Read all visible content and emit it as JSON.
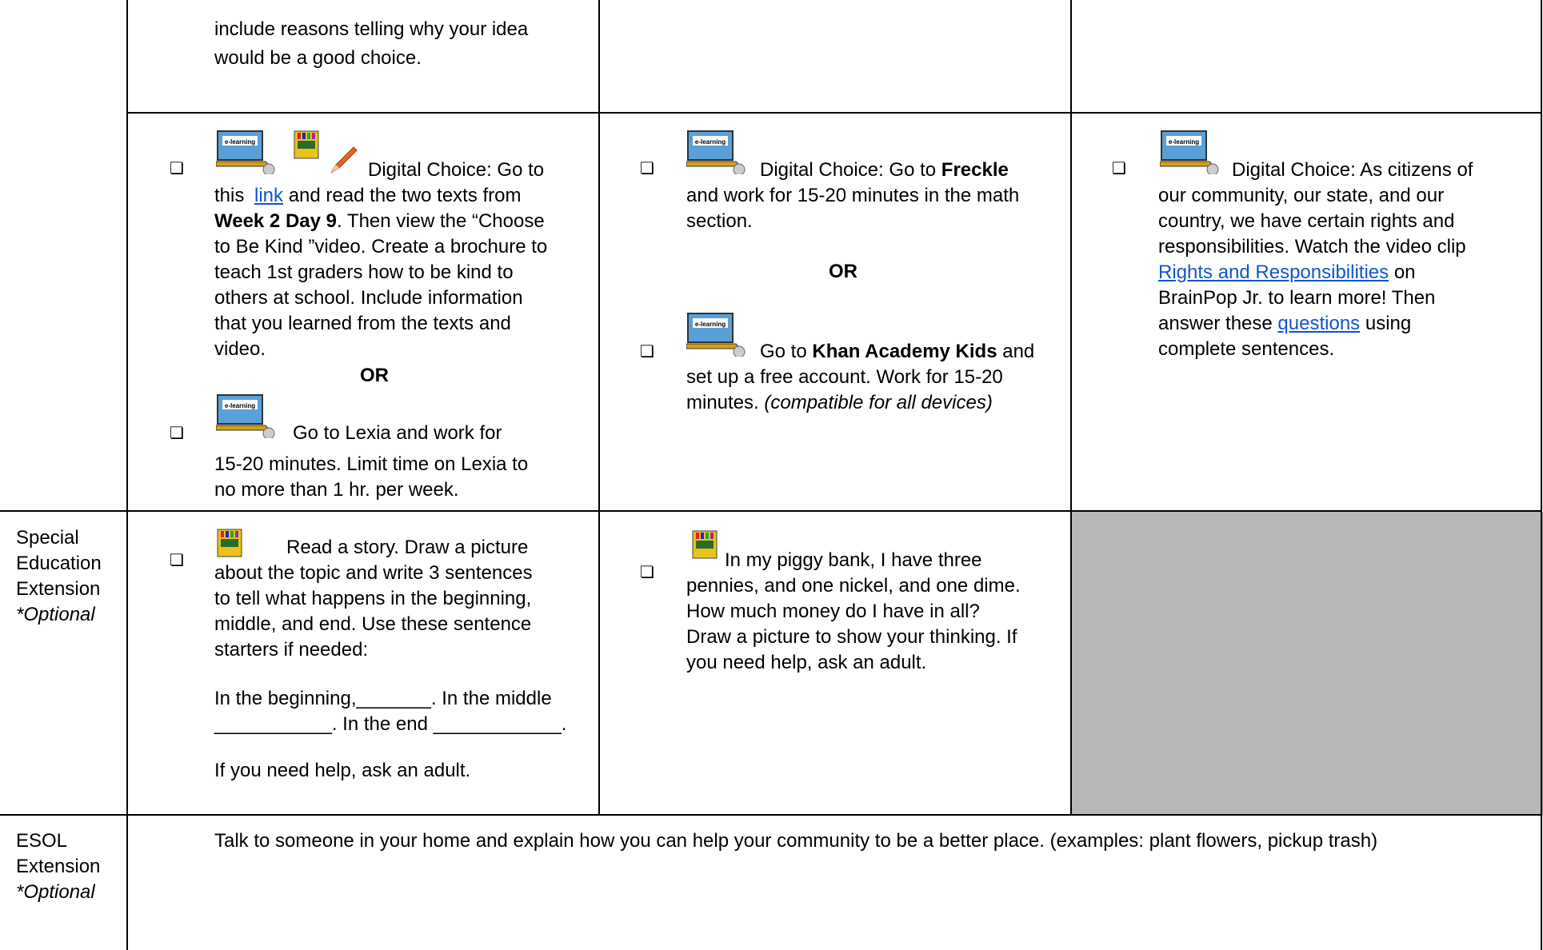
{
  "rows": {
    "top_cont": {
      "reading_cont": [
        "include reasons telling why your idea",
        "would be a good choice."
      ]
    },
    "digital": {
      "reading": {
        "lines": [
          [
            "Digital Choice: Go to"
          ],
          [
            "this ",
            "link",
            " and read the two texts from"
          ],
          [
            "Week 2 Day 9",
            ".  Then view the “Choose"
          ],
          [
            "to Be Kind ”video.  Create a brochure to"
          ],
          [
            "teach 1st graders how to be kind to"
          ],
          [
            "others at school.  Include information"
          ],
          [
            "that you learned from the texts and"
          ],
          [
            "video."
          ]
        ],
        "or": "OR",
        "lexia": [
          "Go to Lexia and work for",
          "15-20 minutes.  Limit time on Lexia to",
          "no more than 1 hr. per week."
        ]
      },
      "math": {
        "freckle": [
          "Digital Choice:  Go to ",
          "Freckle",
          "and work for 15-20 minutes in the math",
          "section."
        ],
        "or": "OR",
        "khan": [
          "Go to ",
          "Khan Academy Kids",
          " and",
          "set up a free account. Work for 15-20",
          "minutes. ",
          "(compatible for all devices)"
        ]
      },
      "social": {
        "lines": [
          "Digital Choice: As citizens of",
          "our community, our state, and our",
          "country, we have certain rights and",
          "responsibilities.  Watch the video clip"
        ],
        "link1": "Rights and Responsibilities",
        "after_link1": " on",
        "line6": "BrainPop Jr. to learn more! Then",
        "line7_pre": "answer these ",
        "link2": "questions",
        "line7_post": " using",
        "line8": "complete sentences."
      }
    },
    "sped": {
      "label": [
        "Special",
        "Education",
        "Extension"
      ],
      "optional": "*Optional",
      "reading": [
        "Read a story. Draw a picture",
        "about the topic and write 3 sentences",
        "to tell what happens in the beginning,",
        "middle, and end. Use these sentence",
        "starters if needed:"
      ],
      "starter1": "In the beginning,_______. In the middle",
      "starter2": "___________. In the end ____________.",
      "help": "If you need help, ask an adult.",
      "math": [
        "In my piggy bank, I have three",
        "pennies, and one nickel, and one dime.",
        "How much money do I have in all?",
        "Draw a picture to show your thinking. If",
        "you need help, ask an adult."
      ]
    },
    "esol": {
      "label": [
        "ESOL",
        "Extension"
      ],
      "optional": "*Optional",
      "text": "Talk to someone in your home and explain how you can help your community to be a better place.  (examples:  plant flowers, pickup trash)"
    }
  },
  "icons": [
    "e-learning-laptop-icon",
    "crayon-box-icon",
    "pencil-icon",
    "checkbox-icon"
  ],
  "colors": {
    "link": "#1155cc",
    "grey_cell": "#b7b7b7",
    "border": "#000000"
  }
}
